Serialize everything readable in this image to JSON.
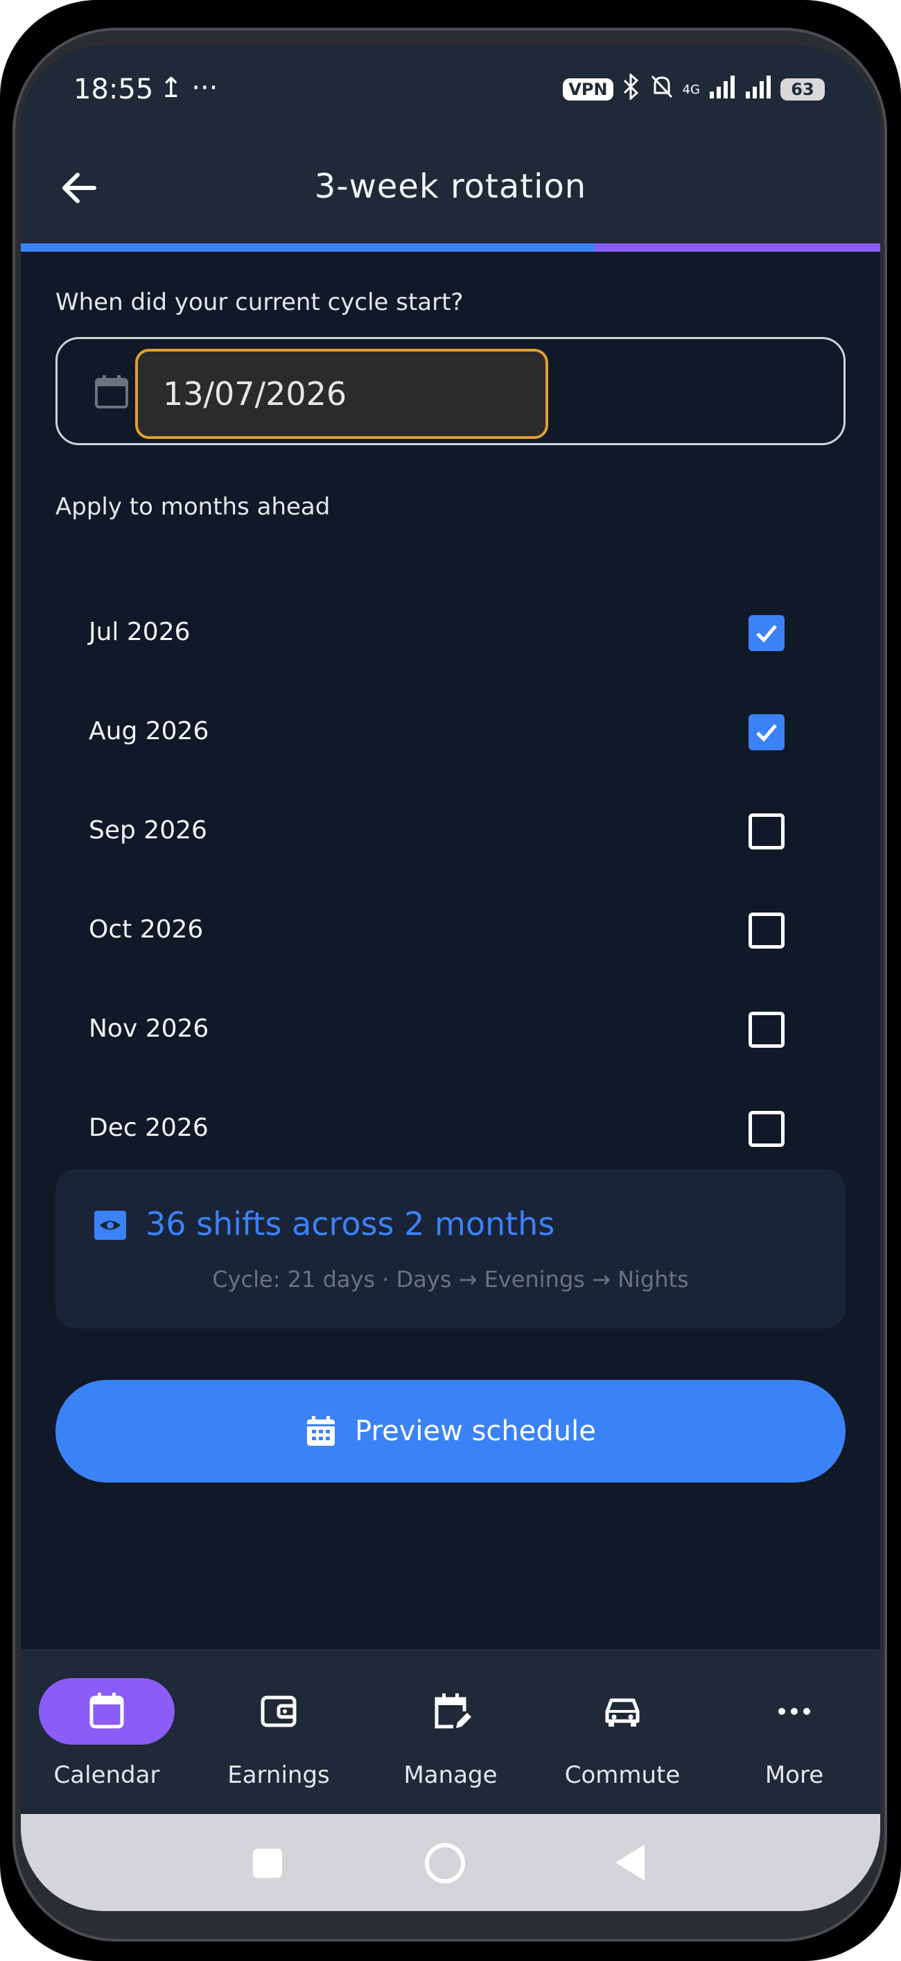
{
  "status_bar": {
    "time": "18:55",
    "left_icons": "↥ ···",
    "vpn": "VPN",
    "network": "4G",
    "battery": "63"
  },
  "app_bar": {
    "title": "3-week rotation",
    "back_icon": "arrow-left-icon"
  },
  "cycle_start": {
    "question": "When did your current cycle start?",
    "date_value": "13/07/2026",
    "icon": "calendar-icon"
  },
  "months": {
    "label": "Apply to months ahead",
    "items": [
      {
        "label": "Jul 2026",
        "checked": true
      },
      {
        "label": "Aug 2026",
        "checked": true
      },
      {
        "label": "Sep 2026",
        "checked": false
      },
      {
        "label": "Oct 2026",
        "checked": false
      },
      {
        "label": "Nov 2026",
        "checked": false
      },
      {
        "label": "Dec 2026",
        "checked": false
      }
    ]
  },
  "summary": {
    "title": "36 shifts across 2 months",
    "subtitle": "Cycle: 21 days · Days → Evenings → Nights",
    "icon": "eye-icon"
  },
  "preview_button": {
    "label": "Preview schedule",
    "icon": "calendar-grid-icon"
  },
  "bottom_nav": [
    {
      "label": "Calendar",
      "icon": "calendar-icon",
      "active": true
    },
    {
      "label": "Earnings",
      "icon": "wallet-icon",
      "active": false
    },
    {
      "label": "Manage",
      "icon": "calendar-edit-icon",
      "active": false
    },
    {
      "label": "Commute",
      "icon": "car-icon",
      "active": false
    },
    {
      "label": "More",
      "icon": "more-dots-icon",
      "active": false
    }
  ],
  "colors": {
    "accent": "#3b82f6",
    "active_nav": "#8b5cf6",
    "background": "#111827",
    "focus_border": "#e0a030"
  }
}
